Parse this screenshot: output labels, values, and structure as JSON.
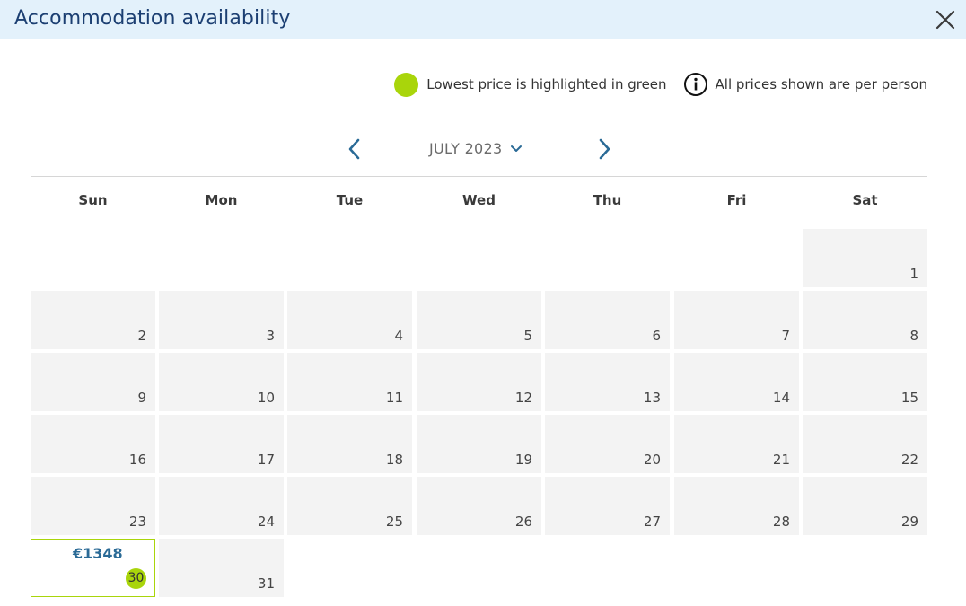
{
  "header": {
    "title": "Accommodation availability",
    "close_icon": "close-icon"
  },
  "legend": {
    "lowest_price_text": "Lowest price is highlighted in green",
    "per_person_text": "All prices shown are per person",
    "highlight_color": "#a9d50b"
  },
  "month_nav": {
    "label": "JULY 2023",
    "prev_icon": "chevron-left-icon",
    "next_icon": "chevron-right-icon"
  },
  "weekdays": [
    "Sun",
    "Mon",
    "Tue",
    "Wed",
    "Thu",
    "Fri",
    "Sat"
  ],
  "calendar": {
    "days": [
      {
        "day": "1"
      },
      {
        "day": "2"
      },
      {
        "day": "3"
      },
      {
        "day": "4"
      },
      {
        "day": "5"
      },
      {
        "day": "6"
      },
      {
        "day": "7"
      },
      {
        "day": "8"
      },
      {
        "day": "9"
      },
      {
        "day": "10"
      },
      {
        "day": "11"
      },
      {
        "day": "12"
      },
      {
        "day": "13"
      },
      {
        "day": "14"
      },
      {
        "day": "15"
      },
      {
        "day": "16"
      },
      {
        "day": "17"
      },
      {
        "day": "18"
      },
      {
        "day": "19"
      },
      {
        "day": "20"
      },
      {
        "day": "21"
      },
      {
        "day": "22"
      },
      {
        "day": "23"
      },
      {
        "day": "24"
      },
      {
        "day": "25"
      },
      {
        "day": "26"
      },
      {
        "day": "27"
      },
      {
        "day": "28"
      },
      {
        "day": "29"
      },
      {
        "day": "30",
        "price": "€1348",
        "lowest": true
      },
      {
        "day": "31"
      }
    ]
  },
  "colors": {
    "accent_blue": "#2a6a96",
    "header_bg": "#e3f1fb",
    "title_color": "#1c3f72",
    "cell_bg": "#f3f3f3"
  }
}
